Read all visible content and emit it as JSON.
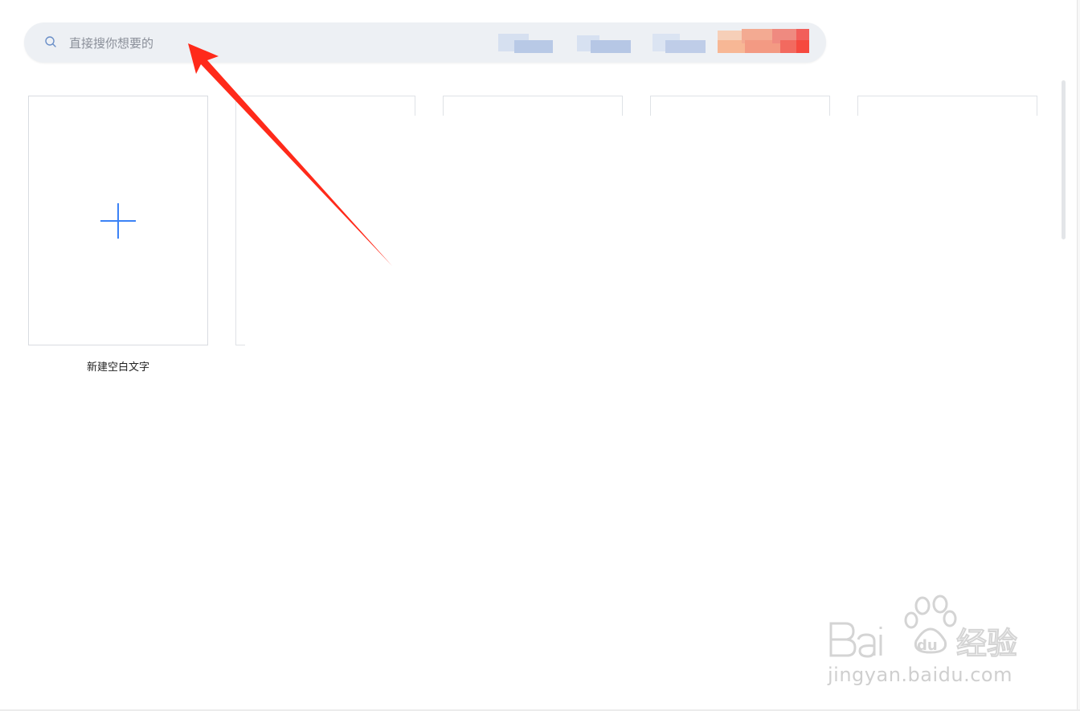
{
  "search": {
    "placeholder": "直接搜你想要的",
    "value": ""
  },
  "templates": {
    "new_blank_label": "新建空白文字"
  },
  "colors": {
    "accent": "#3b82f6",
    "search_bg": "#edf0f4",
    "annotation_arrow": "#ff2a1a"
  },
  "icons": {
    "search": "search-icon",
    "plus": "plus-icon"
  },
  "watermark": {
    "brand": "Baidu经验",
    "url": "jingyan.baidu.com"
  }
}
